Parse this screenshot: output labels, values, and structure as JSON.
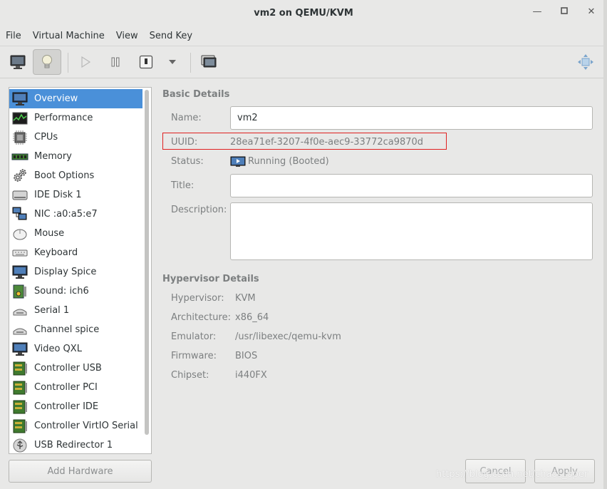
{
  "window": {
    "title": "vm2 on QEMU/KVM"
  },
  "menubar": {
    "items": [
      "File",
      "Virtual Machine",
      "View",
      "Send Key"
    ]
  },
  "toolbar": {
    "buttons": [
      "console-view-icon",
      "details-view-icon",
      "run-icon",
      "pause-icon",
      "shutdown-icon",
      "shutdown-menu-icon",
      "snapshots-icon",
      "fullscreen-icon"
    ],
    "active": "details-view-icon"
  },
  "sidebar": {
    "items": [
      {
        "label": "Overview",
        "icon": "monitor-icon",
        "selected": true
      },
      {
        "label": "Performance",
        "icon": "performance-icon"
      },
      {
        "label": "CPUs",
        "icon": "cpu-icon"
      },
      {
        "label": "Memory",
        "icon": "memory-icon"
      },
      {
        "label": "Boot Options",
        "icon": "gears-icon"
      },
      {
        "label": "IDE Disk 1",
        "icon": "disk-icon"
      },
      {
        "label": "NIC :a0:a5:e7",
        "icon": "network-icon"
      },
      {
        "label": "Mouse",
        "icon": "mouse-icon"
      },
      {
        "label": "Keyboard",
        "icon": "keyboard-icon"
      },
      {
        "label": "Display Spice",
        "icon": "display-icon"
      },
      {
        "label": "Sound: ich6",
        "icon": "sound-card-icon"
      },
      {
        "label": "Serial 1",
        "icon": "serial-icon"
      },
      {
        "label": "Channel spice",
        "icon": "channel-icon"
      },
      {
        "label": "Video QXL",
        "icon": "video-icon"
      },
      {
        "label": "Controller USB",
        "icon": "controller-icon"
      },
      {
        "label": "Controller PCI",
        "icon": "controller-icon"
      },
      {
        "label": "Controller IDE",
        "icon": "controller-icon"
      },
      {
        "label": "Controller VirtIO Serial",
        "icon": "controller-icon"
      },
      {
        "label": "USB Redirector 1",
        "icon": "usb-icon"
      }
    ],
    "add_button": "Add Hardware"
  },
  "basic": {
    "section": "Basic Details",
    "name_label": "Name:",
    "name_value": "vm2",
    "uuid_label": "UUID:",
    "uuid_value": "28ea71ef-3207-4f0e-aec9-33772ca9870d",
    "status_label": "Status:",
    "status_value": "Running (Booted)",
    "title_label": "Title:",
    "title_value": "",
    "description_label": "Description:",
    "description_value": ""
  },
  "hypervisor": {
    "section": "Hypervisor Details",
    "hypervisor_label": "Hypervisor:",
    "hypervisor_value": "KVM",
    "arch_label": "Architecture:",
    "arch_value": "x86_64",
    "emulator_label": "Emulator:",
    "emulator_value": "/usr/libexec/qemu-kvm",
    "firmware_label": "Firmware:",
    "firmware_value": "BIOS",
    "chipset_label": "Chipset:",
    "chipset_value": "i440FX"
  },
  "footer": {
    "cancel": "Cancel",
    "apply": "Apply"
  },
  "watermark": "https://blog.csdn.net/chaos_oper",
  "colors": {
    "selection": "#4a90d9",
    "highlight_box": "#e02020"
  }
}
